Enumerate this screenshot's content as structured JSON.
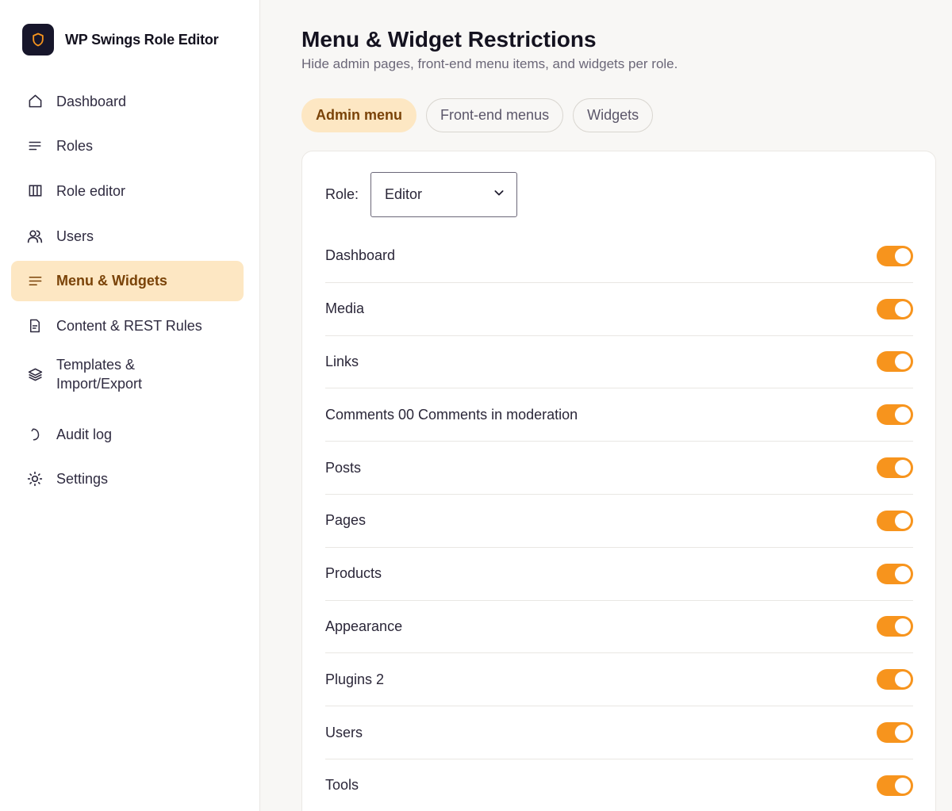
{
  "brand": {
    "name": "WP Swings Role Editor",
    "logo_icon": "shield-icon"
  },
  "sidebar": {
    "items": [
      {
        "label": "Dashboard",
        "icon": "home-icon",
        "active": false
      },
      {
        "label": "Roles",
        "icon": "list-icon",
        "active": false
      },
      {
        "label": "Role editor",
        "icon": "columns-icon",
        "active": false
      },
      {
        "label": "Users",
        "icon": "users-icon",
        "active": false
      },
      {
        "label": "Menu & Widgets",
        "icon": "menu-icon",
        "active": true
      },
      {
        "label": "Content & REST Rules",
        "icon": "document-icon",
        "active": false
      },
      {
        "label": "Templates & Import/Export",
        "icon": "layers-icon",
        "active": false
      },
      {
        "label": "Audit log",
        "icon": "history-icon",
        "active": false
      },
      {
        "label": "Settings",
        "icon": "sun-icon",
        "active": false
      }
    ]
  },
  "header": {
    "title": "Menu & Widget Restrictions",
    "subtitle": "Hide admin pages, front-end menu items, and widgets per role."
  },
  "tabs": [
    {
      "label": "Admin menu",
      "active": true
    },
    {
      "label": "Front-end menus",
      "active": false
    },
    {
      "label": "Widgets",
      "active": false
    }
  ],
  "role_filter": {
    "label": "Role:",
    "selected": "Editor"
  },
  "menu_items": [
    {
      "label": "Dashboard",
      "enabled": true
    },
    {
      "label": "Media",
      "enabled": true
    },
    {
      "label": "Links",
      "enabled": true
    },
    {
      "label": "Comments 00 Comments in moderation",
      "enabled": true
    },
    {
      "label": "Posts",
      "enabled": true
    },
    {
      "label": "Pages",
      "enabled": true
    },
    {
      "label": "Products",
      "enabled": true
    },
    {
      "label": "Appearance",
      "enabled": true
    },
    {
      "label": "Plugins 2",
      "enabled": true
    },
    {
      "label": "Users",
      "enabled": true
    },
    {
      "label": "Tools",
      "enabled": true
    }
  ],
  "colors": {
    "accent": "#f7941d",
    "active_bg": "#fde7c3",
    "active_text": "#7a4308",
    "logo_bg": "#17162b"
  }
}
